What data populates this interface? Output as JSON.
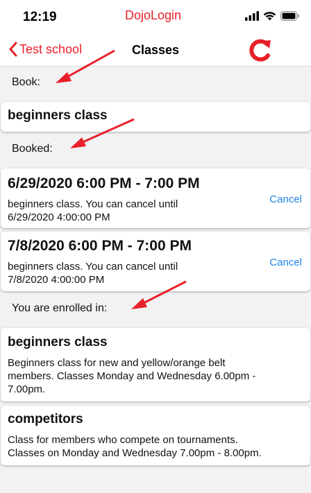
{
  "status_bar": {
    "time": "12:19"
  },
  "annotation": {
    "app_name": "DojoLogin"
  },
  "nav": {
    "back_label": "Test school",
    "title": "Classes"
  },
  "book": {
    "label": "Book:",
    "items": [
      {
        "title": "beginners class"
      }
    ]
  },
  "booked": {
    "label": "Booked:",
    "items": [
      {
        "title": "6/29/2020 6:00 PM - 7:00 PM",
        "line1": "beginners class. You can cancel until",
        "line2": "6/29/2020 4:00:00 PM",
        "action": "Cancel"
      },
      {
        "title": "7/8/2020 6:00 PM - 7:00 PM",
        "line1": "beginners class. You can cancel until",
        "line2": "7/8/2020 4:00:00 PM",
        "action": "Cancel"
      }
    ]
  },
  "enrolled": {
    "label": "You are enrolled in:",
    "items": [
      {
        "title": "beginners class",
        "line1": "Beginners class for new and yellow/orange belt",
        "line2": "members. Classes Monday and Wednesday 6.00pm -",
        "line3": "7.00pm."
      },
      {
        "title": "competitors",
        "line1": "Class for members who compete on tournaments.",
        "line2": "Classes on Monday and Wednesday 7.00pm - 8.00pm."
      }
    ]
  },
  "colors": {
    "accent": "#e8202a",
    "link": "#1e88e5",
    "background": "#f2f2f2",
    "card": "#ffffff"
  }
}
